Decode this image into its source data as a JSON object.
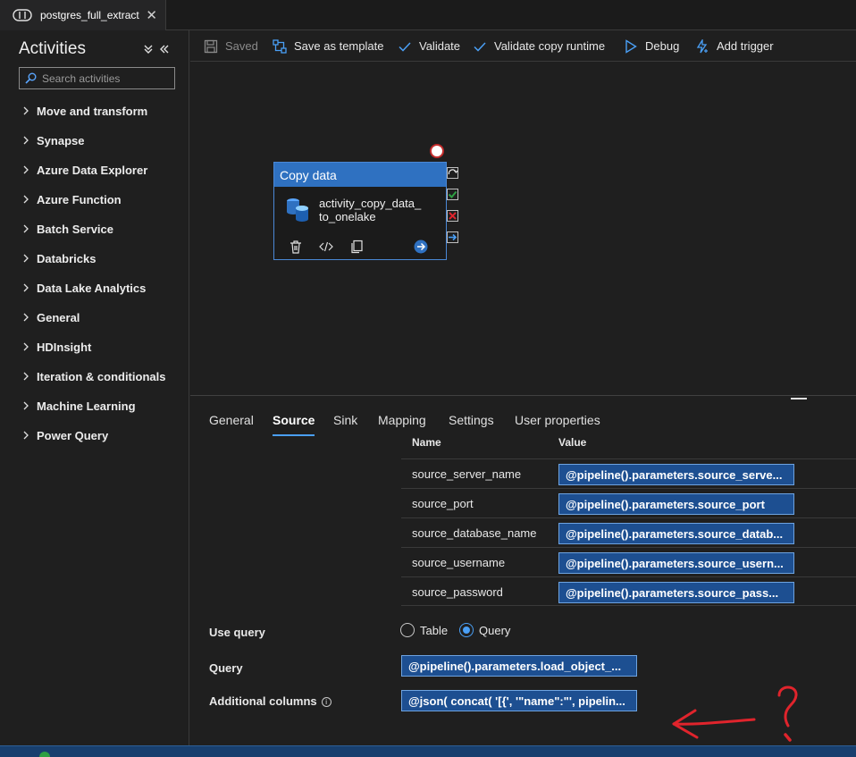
{
  "tab": {
    "title": "postgres_full_extract",
    "close": "✕"
  },
  "activities": {
    "title": "Activities",
    "search_placeholder": "Search activities",
    "categories": [
      "Move and transform",
      "Synapse",
      "Azure Data Explorer",
      "Azure Function",
      "Batch Service",
      "Databricks",
      "Data Lake Analytics",
      "General",
      "HDInsight",
      "Iteration & conditionals",
      "Machine Learning",
      "Power Query"
    ]
  },
  "toolbar": {
    "saved": "Saved",
    "save_as_template": "Save as template",
    "validate": "Validate",
    "validate_copy_runtime": "Validate copy runtime",
    "debug": "Debug",
    "add_trigger": "Add trigger"
  },
  "activity": {
    "type": "Copy data",
    "name_line1": "activity_copy_data_",
    "name_line2": "to_onelake"
  },
  "props": {
    "tabs": [
      "General",
      "Source",
      "Sink",
      "Mapping",
      "Settings",
      "User properties"
    ],
    "active_tab": "Source",
    "table_headers": {
      "name": "Name",
      "value": "Value"
    },
    "parameters": [
      {
        "name": "source_server_name",
        "value": "@pipeline().parameters.source_serve..."
      },
      {
        "name": "source_port",
        "value": "@pipeline().parameters.source_port"
      },
      {
        "name": "source_database_name",
        "value": "@pipeline().parameters.source_datab..."
      },
      {
        "name": "source_username",
        "value": "@pipeline().parameters.source_usern..."
      },
      {
        "name": "source_password",
        "value": "@pipeline().parameters.source_pass..."
      }
    ],
    "use_query_label": "Use query",
    "use_query_options": [
      "Table",
      "Query"
    ],
    "use_query_selected": "Query",
    "query_label": "Query",
    "query_value": "@pipeline().parameters.load_object_...",
    "additional_columns_label": "Additional columns",
    "additional_columns_value": "@json( concat( '[{', '\"name\":\"', pipelin..."
  },
  "colors": {
    "accent": "#4a9ff5",
    "node_header": "#2f71c1",
    "expression_bg": "#1d4f91",
    "annotation": "#e0242c"
  }
}
